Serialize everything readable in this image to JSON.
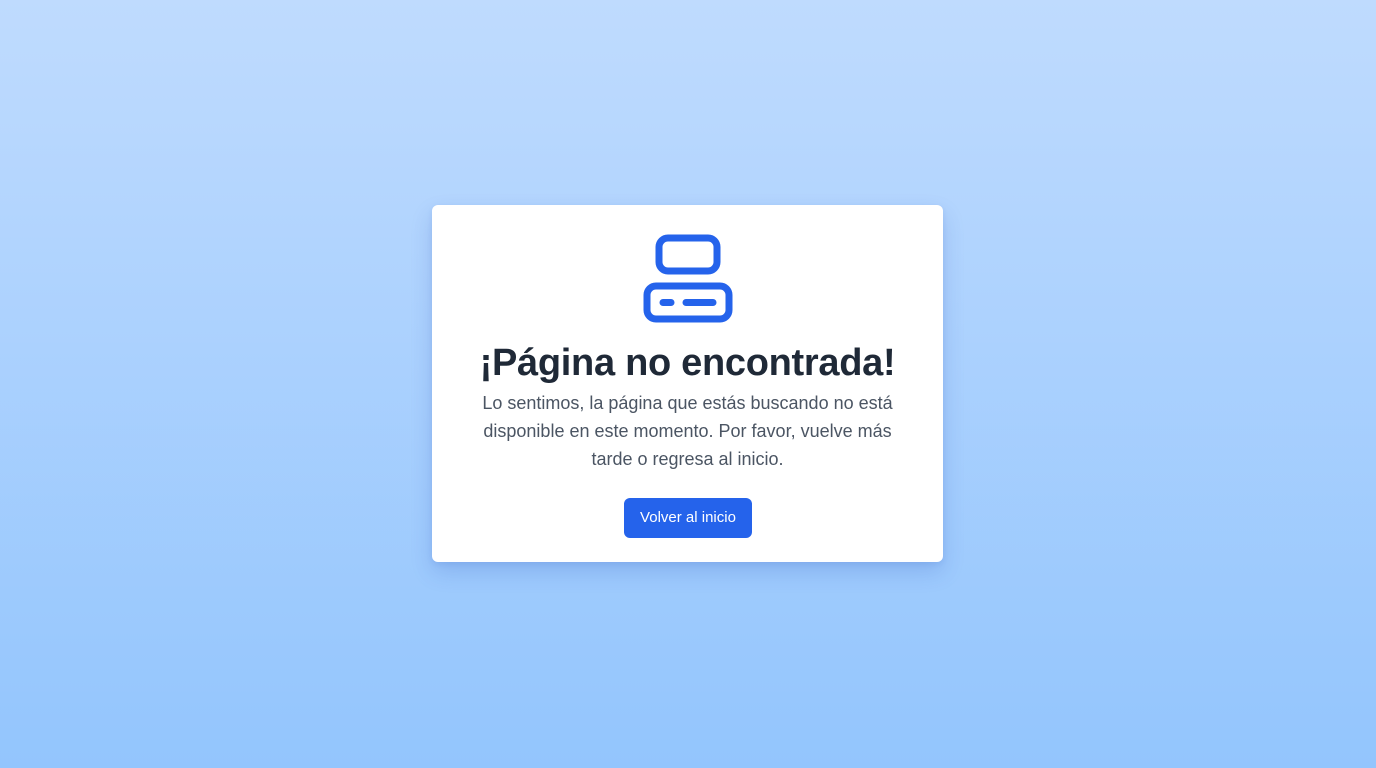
{
  "error_card": {
    "icon": "server-icon",
    "title": "¡Página no encontrada!",
    "message": "Lo sentimos, la página que estás buscando no está disponible en este momento. Por favor, vuelve más tarde o regresa al inicio.",
    "button_label": "Volver al inicio"
  },
  "colors": {
    "accent": "#2563eb",
    "title": "#1f2937",
    "text": "#4b5563",
    "background_top": "#bfdbfe",
    "background_bottom": "#93c5fd"
  }
}
